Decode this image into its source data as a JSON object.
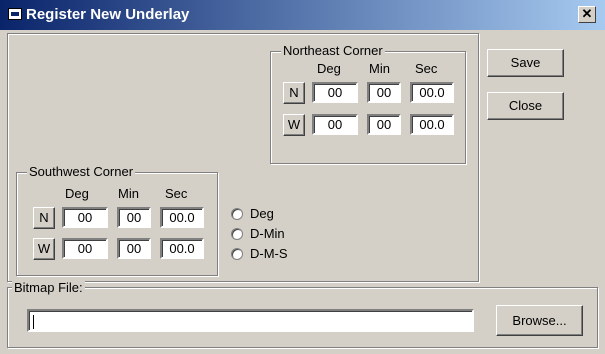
{
  "window": {
    "title": "Register New Underlay",
    "close_glyph": "✕"
  },
  "northeast": {
    "label": "Northeast Corner",
    "headers": [
      "Deg",
      "Min",
      "Sec"
    ],
    "rows": [
      {
        "dir": "N",
        "deg": "00",
        "min": "00",
        "sec": "00.0"
      },
      {
        "dir": "W",
        "deg": "00",
        "min": "00",
        "sec": "00.0"
      }
    ]
  },
  "southwest": {
    "label": "Southwest Corner",
    "headers": [
      "Deg",
      "Min",
      "Sec"
    ],
    "rows": [
      {
        "dir": "N",
        "deg": "00",
        "min": "00",
        "sec": "00.0"
      },
      {
        "dir": "W",
        "deg": "00",
        "min": "00",
        "sec": "00.0"
      }
    ]
  },
  "format": {
    "options": [
      "Deg",
      "D-Min",
      "D-M-S"
    ]
  },
  "buttons": {
    "save": "Save",
    "close": "Close",
    "browse": "Browse..."
  },
  "bitmap": {
    "label": "Bitmap File:",
    "value": ""
  }
}
